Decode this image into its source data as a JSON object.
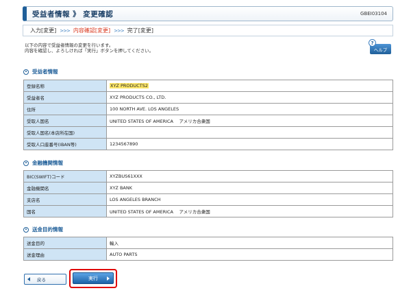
{
  "header": {
    "title": "受益者情報 》 変更確認",
    "screen_code": "GBEI03104"
  },
  "steps": [
    {
      "label": "入力[変更]",
      "active": false
    },
    {
      "label": "内容確認[変更]",
      "active": true
    },
    {
      "label": "完了[変更]",
      "active": false
    }
  ],
  "step_arrow": ">>>",
  "instructions": [
    "以下の内容で受益者情報の変更を行います。",
    "内容を確認し、よろしければ「実行」ボタンを押してください。"
  ],
  "help": {
    "label": "ヘルプ",
    "icon": "question-icon",
    "glyph": "?"
  },
  "sections": {
    "beneficiary": {
      "title": "受益者情報",
      "rows": [
        {
          "label": "登録名称",
          "value": "XYZ PRODUCTS2"
        },
        {
          "label": "受益者名",
          "value": "XYZ PRODUCTS CO., LTD."
        },
        {
          "label": "住所",
          "value": "100 NORTH AVE. LOS ANGELES"
        },
        {
          "label": "受取人国名",
          "value": "UNITED STATES OF AMERICA　 アメリカ合衆国"
        },
        {
          "label": "受取人国名(本店所在国)",
          "value": ""
        },
        {
          "label": "受取人口座番号(IBAN等)",
          "value": "1234567890"
        }
      ]
    },
    "bank": {
      "title": "金融機関情報",
      "rows": [
        {
          "label": "BIC(SWIFT)コード",
          "value": "XYZBUS61XXX"
        },
        {
          "label": "金融機関名",
          "value": "XYZ BANK"
        },
        {
          "label": "支店名",
          "value": "LOS ANGELES BRANCH"
        },
        {
          "label": "国名",
          "value": "UNITED STATES OF AMERICA　 アメリカ合衆国"
        }
      ]
    },
    "purpose": {
      "title": "送金目的情報",
      "rows": [
        {
          "label": "送金目的",
          "value": "輸入"
        },
        {
          "label": "送金理由",
          "value": "AUTO PARTS"
        }
      ]
    }
  },
  "buttons": {
    "back": "戻る",
    "execute": "実行"
  },
  "colors": {
    "accent": "#1f5f99",
    "active_step": "#d9381e",
    "label_bg": "#cfe4f5",
    "highlight": "#ffe86a",
    "callout": "#e00000"
  }
}
